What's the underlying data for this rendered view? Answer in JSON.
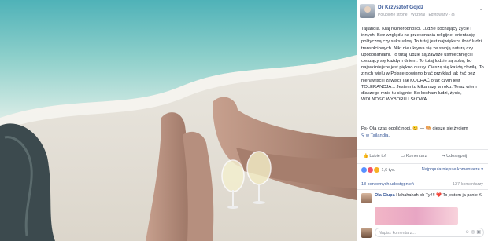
{
  "post": {
    "author": "Dr Krzysztof Gojdź",
    "meta": "Polubione stronę · Wczoraj · Edytowany · ",
    "text": "Tajlandia. Kraj różnorodności. Ludzie kochający życie i innych. Bez względu na przekonania religijne, orientację polityczną czy seksualną. To tutaj jest największa ilość ludzi transpłciowych. Nikt nie ukrywa się ze swoją naturą czy upodobaniami. To tutaj ludzie są zawsze uśmiechnięci i cieszący się każdym dniem. To tutaj ludzie są sobą, bo najważniejsze jest piękno duszy. Cieszą się każdą chwilą. To z nich wielu w Polsce powinno brać przykład jak żyć bez nienawiści i zawiści, jak KOCHAĆ oraz czym jest TOLERANCJA... Jestem tu kilka razy w roku. Teraz wiem dlaczego mnie tu ciągnie. Bo kocham ludzi, życie, WOLNOŚĆ WYBORU I SŁOWA..",
    "ps": "Ps· Ola czas ogolić nogi..😊 — 🎨 cieszę się życiem",
    "location": "w Tajlandia."
  },
  "actions": {
    "like": "Lubię to!",
    "comment": "Komentarz",
    "share": "Udostępnij"
  },
  "reactions": {
    "count": "1,6 tys.",
    "sort": "Najpopularniejsze komentarze ▾"
  },
  "stats": {
    "shares": "18 ponownych udostępnień",
    "comments": "137 komentarzy"
  },
  "comment": {
    "author": "Ola Ciupa",
    "text": "Hahahahah oh Ty !!! ❤️ To jestem ja panie K."
  },
  "write": {
    "placeholder": "Napisz komentarz...",
    "icons": "☺ ◎ ▣"
  },
  "colors": {
    "link": "#385898",
    "sea": "#7fc7c7",
    "sand": "#e9e6df"
  }
}
